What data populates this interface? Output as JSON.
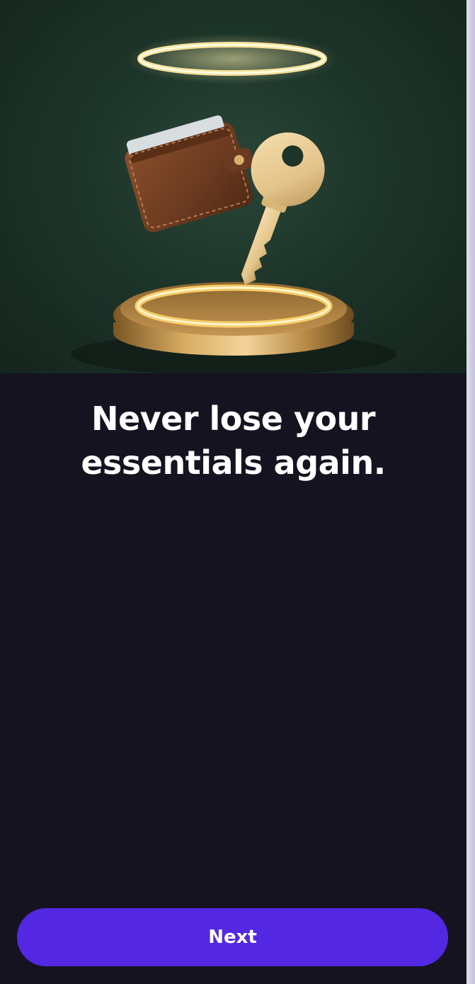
{
  "onboarding": {
    "headline": "Never lose your essentials again.",
    "next_label": "Next"
  },
  "hero_illustration": {
    "subject": "wallet and key on golden pedestal with halo"
  },
  "colors": {
    "background": "#14131f",
    "button": "#5427e3",
    "text": "#ffffff",
    "hero_background": "#1d3429"
  }
}
